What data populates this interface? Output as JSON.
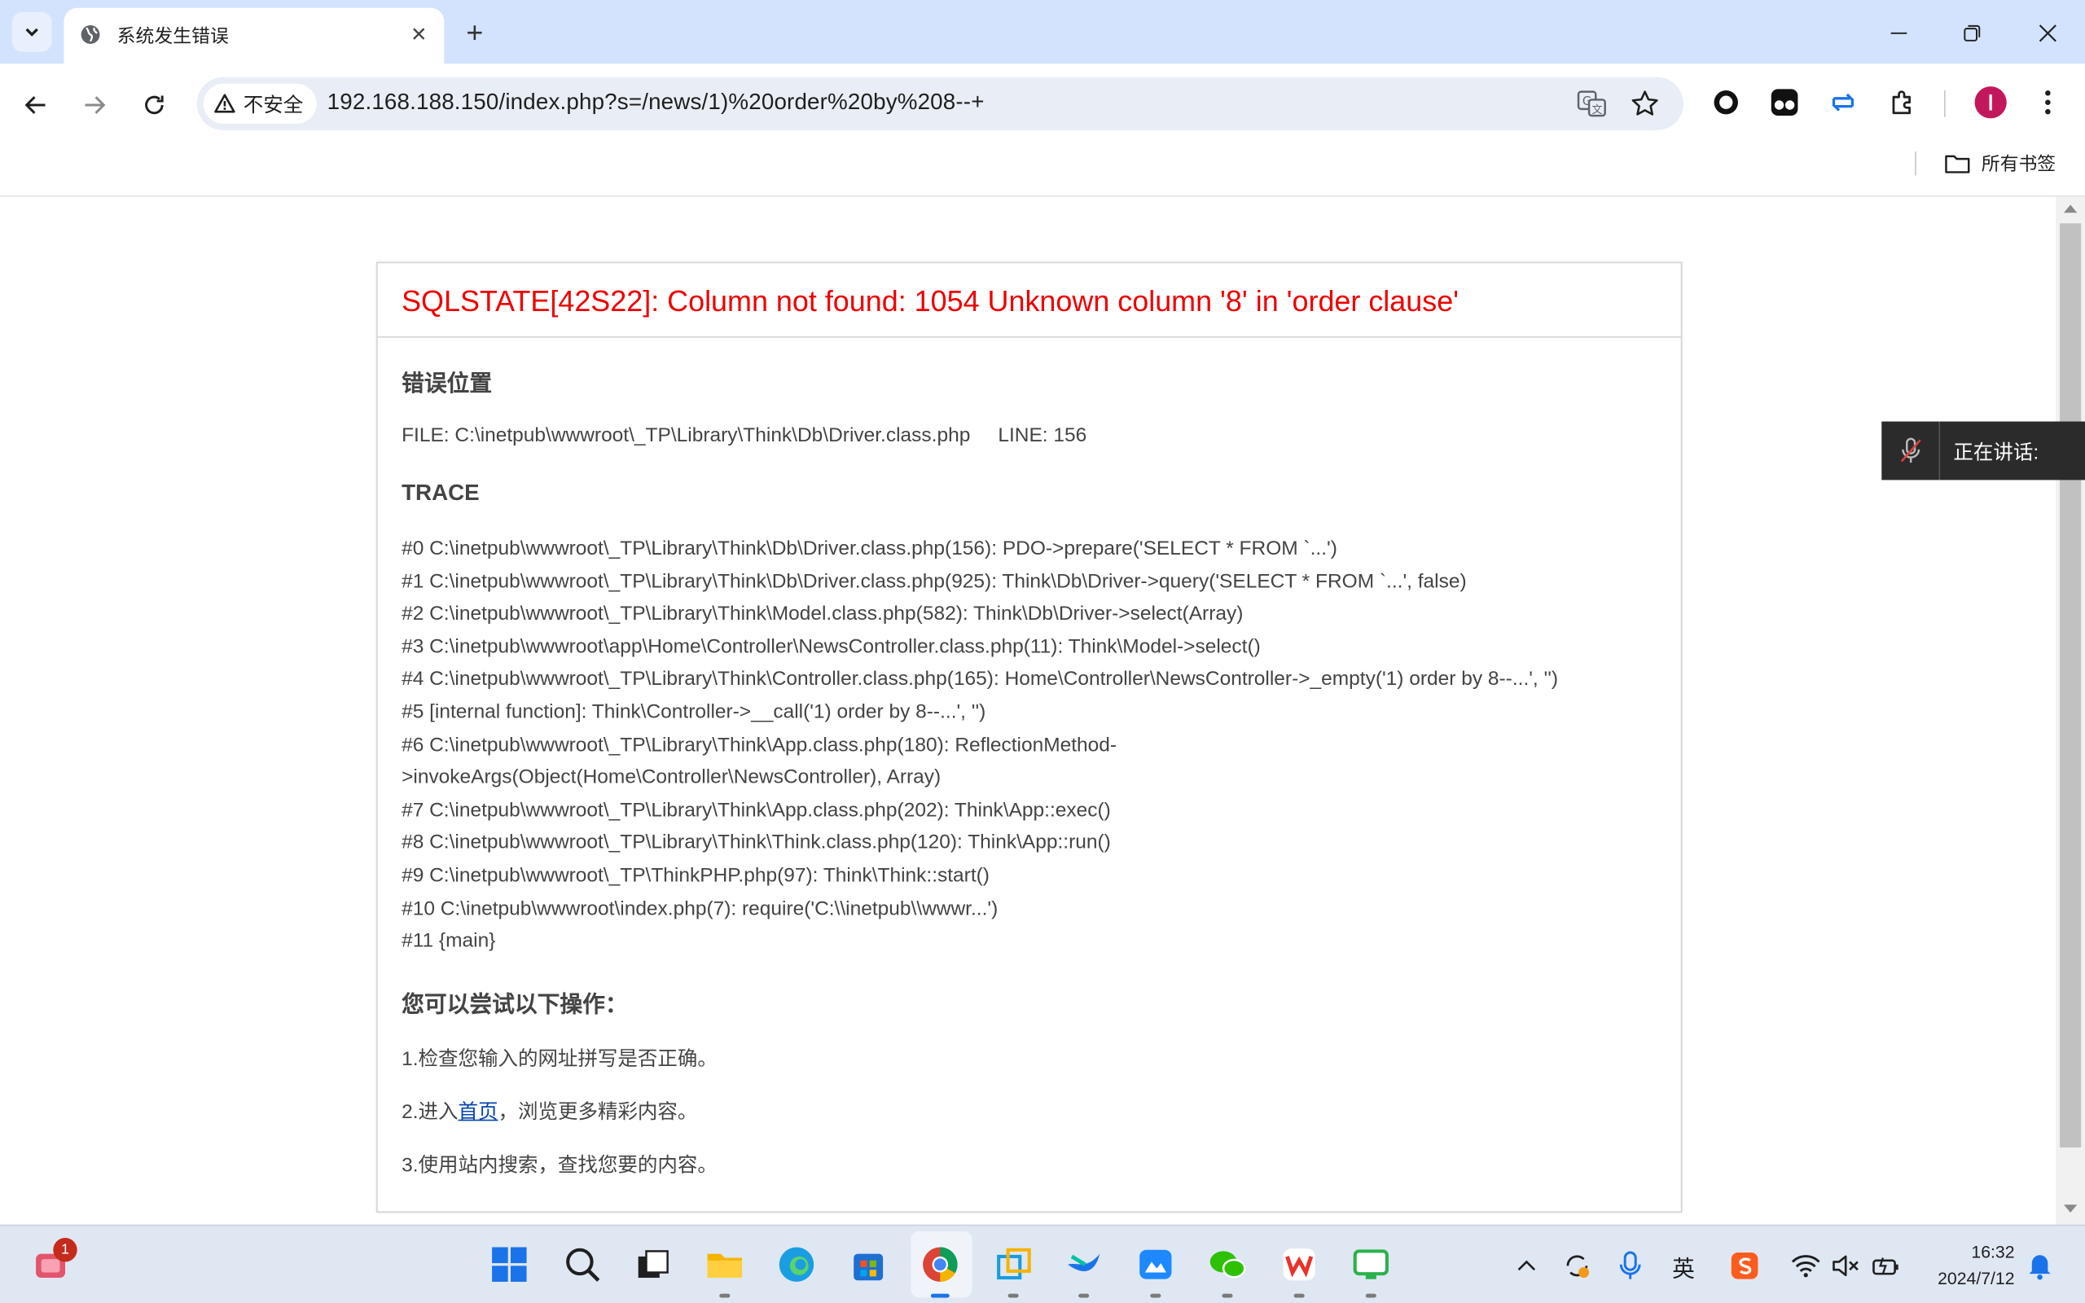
{
  "tab": {
    "title": "系统发生错误"
  },
  "omnibox": {
    "security_label": "不安全",
    "url": "192.168.188.150/index.php?s=/news/1)%20order%20by%208--+"
  },
  "bookmarks": {
    "all_bookmarks_label": "所有书签"
  },
  "error": {
    "title": "SQLSTATE[42S22]: Column not found: 1054 Unknown column '8' in 'order clause'",
    "location_heading": "错误位置",
    "file_line": "FILE: C:\\inetpub\\wwwroot\\_TP\\Library\\Think\\Db\\Driver.class.php     LINE: 156",
    "trace_heading": "TRACE",
    "trace": [
      "#0 C:\\inetpub\\wwwroot\\_TP\\Library\\Think\\Db\\Driver.class.php(156): PDO->prepare('SELECT * FROM `...')",
      "#1 C:\\inetpub\\wwwroot\\_TP\\Library\\Think\\Db\\Driver.class.php(925): Think\\Db\\Driver->query('SELECT * FROM `...', false)",
      "#2 C:\\inetpub\\wwwroot\\_TP\\Library\\Think\\Model.class.php(582): Think\\Db\\Driver->select(Array)",
      "#3 C:\\inetpub\\wwwroot\\app\\Home\\Controller\\NewsController.class.php(11): Think\\Model->select()",
      "#4 C:\\inetpub\\wwwroot\\_TP\\Library\\Think\\Controller.class.php(165): Home\\Controller\\NewsController->_empty('1) order by 8--...', '')",
      "#5 [internal function]: Think\\Controller->__call('1) order by 8--...', '')",
      "#6 C:\\inetpub\\wwwroot\\_TP\\Library\\Think\\App.class.php(180): ReflectionMethod-",
      ">invokeArgs(Object(Home\\Controller\\NewsController), Array)",
      "#7 C:\\inetpub\\wwwroot\\_TP\\Library\\Think\\App.class.php(202): Think\\App::exec()",
      "#8 C:\\inetpub\\wwwroot\\_TP\\Library\\Think\\Think.class.php(120): Think\\App::run()",
      "#9 C:\\inetpub\\wwwroot\\_TP\\ThinkPHP.php(97): Think\\Think::start()",
      "#10 C:\\inetpub\\wwwroot\\index.php(7): require('C:\\\\inetpub\\\\wwwr...')",
      "#11 {main}"
    ],
    "actions_heading": "您可以尝试以下操作：",
    "action1": "1.检查您输入的网址拼写是否正确。",
    "action2_prefix": "2.进入",
    "action2_link": "首页",
    "action2_suffix": "，浏览更多精彩内容。",
    "action3": "3.使用站内搜索，查找您要的内容。"
  },
  "speaking_widget": {
    "label": "正在讲话:"
  },
  "taskbar": {
    "notification_badge": "1",
    "ime_label": "英",
    "time": "16:32",
    "date": "2024/7/12"
  },
  "colors": {
    "tabbar": "#d3e3fd",
    "error_title": "#ee0000",
    "link": "#0645ad",
    "profile": "#c2185b"
  }
}
